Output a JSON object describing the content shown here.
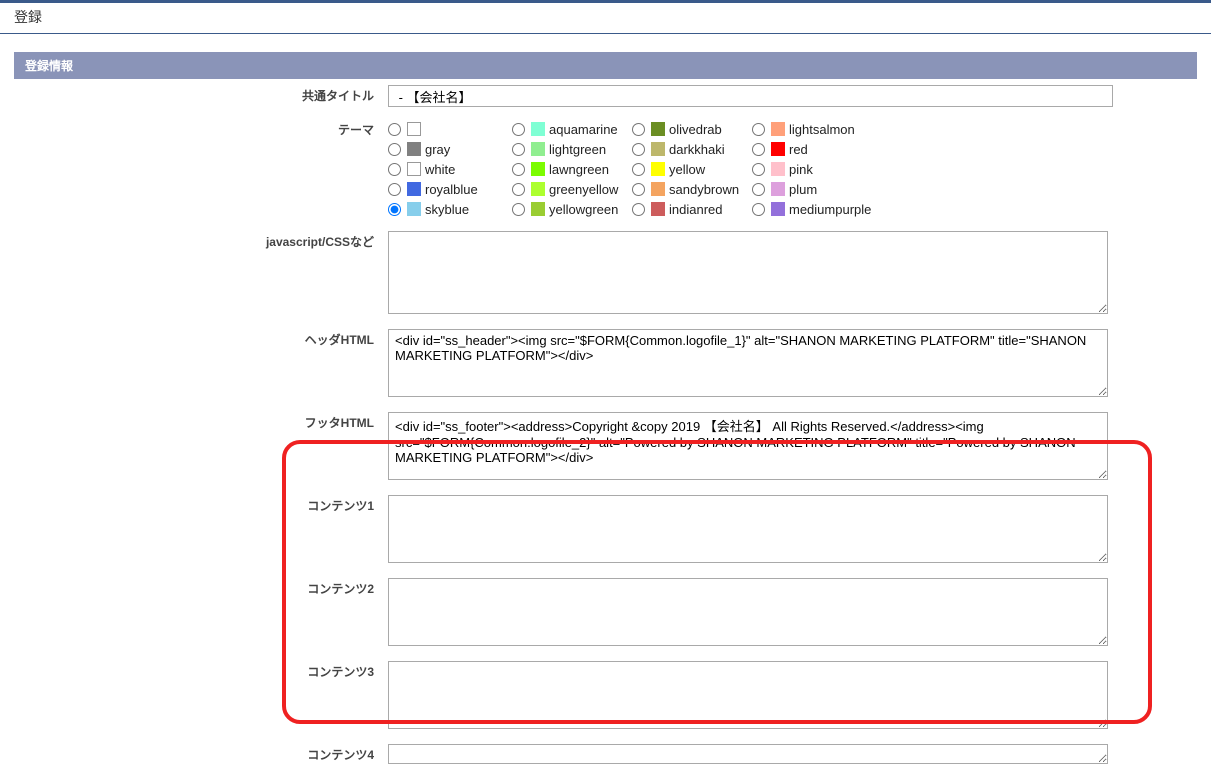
{
  "header": {
    "title": "登録"
  },
  "panel": {
    "title": "登録情報"
  },
  "form": {
    "common_title_label": "共通タイトル",
    "common_title_value": " - 【会社名】",
    "theme_label": "テーマ",
    "themes": {
      "col1": [
        {
          "name": "",
          "color": "#ffffff",
          "bordered": true
        },
        {
          "name": "gray",
          "color": "#808080"
        },
        {
          "name": "white",
          "color": "#ffffff",
          "bordered": true
        },
        {
          "name": "royalblue",
          "color": "#4169e1"
        },
        {
          "name": "skyblue",
          "color": "#87ceeb",
          "checked": true
        }
      ],
      "col2": [
        {
          "name": "aquamarine",
          "color": "#7fffd4"
        },
        {
          "name": "lightgreen",
          "color": "#90ee90"
        },
        {
          "name": "lawngreen",
          "color": "#7cfc00"
        },
        {
          "name": "greenyellow",
          "color": "#adff2f"
        },
        {
          "name": "yellowgreen",
          "color": "#9acd32"
        }
      ],
      "col3": [
        {
          "name": "olivedrab",
          "color": "#6b8e23"
        },
        {
          "name": "darkkhaki",
          "color": "#bdb76b"
        },
        {
          "name": "yellow",
          "color": "#ffff00"
        },
        {
          "name": "sandybrown",
          "color": "#f4a460"
        },
        {
          "name": "indianred",
          "color": "#cd5c5c"
        }
      ],
      "col4": [
        {
          "name": "lightsalmon",
          "color": "#ffa07a"
        },
        {
          "name": "red",
          "color": "#ff0000"
        },
        {
          "name": "pink",
          "color": "#ffc0cb"
        },
        {
          "name": "plum",
          "color": "#dda0dd"
        },
        {
          "name": "mediumpurple",
          "color": "#9370db"
        }
      ]
    },
    "jscss_label": "javascript/CSSなど",
    "jscss_value": "",
    "header_html_label": "ヘッダHTML",
    "header_html_value": "<div id=\"ss_header\"><img src=\"$FORM{Common.logofile_1}\" alt=\"SHANON MARKETING PLATFORM\" title=\"SHANON MARKETING PLATFORM\"></div>",
    "footer_html_label": "フッタHTML",
    "footer_html_value": "<div id=\"ss_footer\"><address>Copyright &copy 2019 【会社名】 All Rights Reserved.</address><img src=\"$FORM{Common.logofile_2}\" alt=\"Powered by SHANON MARKETING PLATFORM\" title=\"Powered by SHANON MARKETING PLATFORM\"></div>",
    "content1_label": "コンテンツ1",
    "content1_value": "",
    "content2_label": "コンテンツ2",
    "content2_value": "",
    "content3_label": "コンテンツ3",
    "content3_value": "",
    "content4_label": "コンテンツ4",
    "content4_value": ""
  }
}
